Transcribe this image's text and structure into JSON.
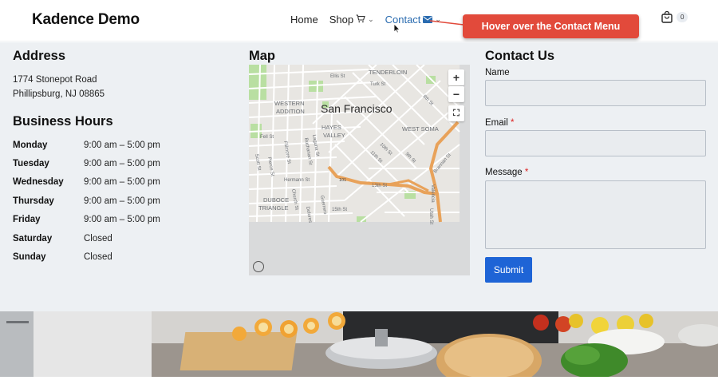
{
  "header": {
    "logo": "Kadence Demo",
    "nav": [
      {
        "label": "Home"
      },
      {
        "label": "Shop"
      },
      {
        "label": "Contact"
      }
    ],
    "cart_count": "0",
    "callout": "Hover over the Contact Menu"
  },
  "address": {
    "title": "Address",
    "line1": "1774 Stonepot Road",
    "line2": "Phillipsburg, NJ 08865"
  },
  "hours": {
    "title": "Business Hours",
    "rows": [
      {
        "day": "Monday",
        "time": "9:00 am – 5:00 pm"
      },
      {
        "day": "Tuesday",
        "time": "9:00 am – 5:00 pm"
      },
      {
        "day": "Wednesday",
        "time": "9:00 am – 5:00 pm"
      },
      {
        "day": "Thursday",
        "time": "9:00 am – 5:00 pm"
      },
      {
        "day": "Friday",
        "time": "9:00 am – 5:00 pm"
      },
      {
        "day": "Saturday",
        "time": "Closed"
      },
      {
        "day": "Sunday",
        "time": "Closed"
      }
    ]
  },
  "map": {
    "title": "Map",
    "city_label": "San Francisco",
    "labels": [
      "TENDERLOIN",
      "Ellis St",
      "Turk St",
      "WESTERN",
      "ADDITION",
      "HAYES",
      "VALLEY",
      "WEST SOMA",
      "Fell St",
      "Hermann St",
      "DUBOCE",
      "TRIANGLE",
      "13th St",
      "15th St",
      "10th St",
      "11th St",
      "9th St",
      "8th St",
      "Brannan St",
      "Scott St",
      "Pierce St",
      "Fillmore St",
      "Laguna St",
      "Buchanan St",
      "Church St",
      "Guerrero",
      "Valencia",
      "Utah St",
      "Dolores",
      "101"
    ],
    "zoom_in": "+",
    "zoom_out": "−"
  },
  "contact": {
    "title": "Contact Us",
    "name_label": "Name",
    "email_label": "Email",
    "message_label": "Message",
    "required_mark": "*",
    "submit_label": "Submit"
  },
  "colors": {
    "accent": "#1e64d6",
    "nav_active": "#2b6cb0",
    "callout": "#e24a3b",
    "panel_bg": "#edf0f3"
  }
}
